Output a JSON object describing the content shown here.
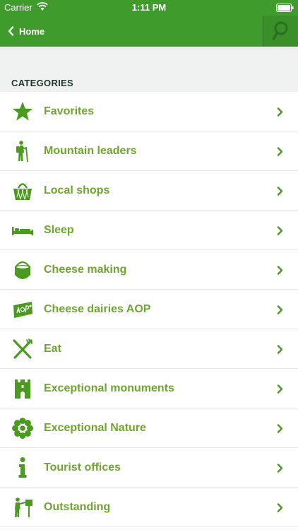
{
  "status_bar": {
    "carrier": "Carrier",
    "time": "1:11 PM"
  },
  "nav": {
    "back_label": "Home"
  },
  "section": {
    "title": "CATEGORIES"
  },
  "colors": {
    "brand_green": "#3e9b2c",
    "label_green": "#6fa52e",
    "icon_green": "#4a9a1f"
  },
  "categories": [
    {
      "label": "Favorites",
      "icon": "star-icon"
    },
    {
      "label": "Mountain leaders",
      "icon": "hiker-icon"
    },
    {
      "label": "Local shops",
      "icon": "basket-icon"
    },
    {
      "label": "Sleep",
      "icon": "bed-icon"
    },
    {
      "label": "Cheese making",
      "icon": "cheese-pot-icon"
    },
    {
      "label": "Cheese dairies AOP",
      "icon": "aop-label-icon"
    },
    {
      "label": "Eat",
      "icon": "fork-knife-icon"
    },
    {
      "label": "Exceptional monuments",
      "icon": "castle-icon"
    },
    {
      "label": "Exceptional Nature",
      "icon": "flower-icon"
    },
    {
      "label": "Tourist offices",
      "icon": "info-icon"
    },
    {
      "label": "Outstanding",
      "icon": "guide-sign-icon"
    }
  ]
}
